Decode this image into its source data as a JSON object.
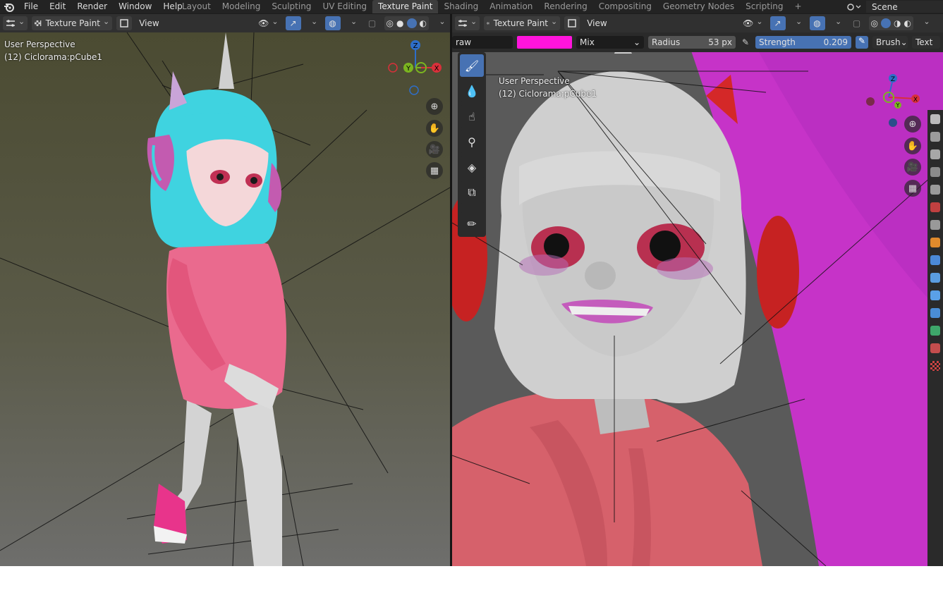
{
  "menu": {
    "items": [
      "File",
      "Edit",
      "Render",
      "Window",
      "Help"
    ]
  },
  "workspaces": {
    "tabs": [
      "Layout",
      "Modeling",
      "Sculpting",
      "UV Editing",
      "Texture Paint",
      "Shading",
      "Animation",
      "Rendering",
      "Compositing",
      "Geometry Nodes",
      "Scripting"
    ],
    "active": "Texture Paint",
    "add_label": "+"
  },
  "scene": {
    "label": "Scene"
  },
  "left_editor": {
    "mode_label": "Texture Paint",
    "view_label": "View",
    "perspective": "User Perspective",
    "object_info": "(12) Ciclorama:pCube1"
  },
  "right_editor": {
    "mode_label": "Texture Paint",
    "view_label": "View",
    "perspective": "User Perspective",
    "object_info": "(12) Ciclorama:pCube1",
    "tool_settings": {
      "brush_name": "raw",
      "color": "#ff14dc",
      "blend": "Mix",
      "radius_label": "Radius",
      "radius_value": "53 px",
      "strength_label": "Strength",
      "strength_value": "0.209",
      "brush_menu": "Brush",
      "texture_menu": "Text"
    }
  },
  "gizmo": {
    "x": "X",
    "y": "Y",
    "z": "Z"
  },
  "colors": {
    "accent": "#4772b3",
    "hair": "#3fd3e0",
    "hoodie": "#e76b8c",
    "backdrop": "#c633c8"
  }
}
